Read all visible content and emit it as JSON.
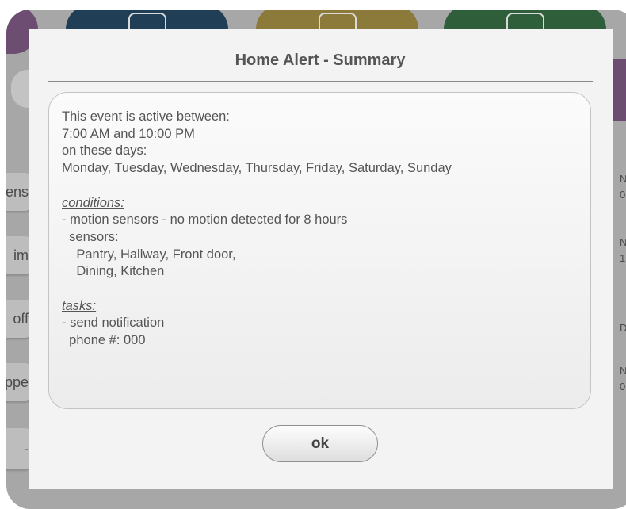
{
  "background": {
    "tiles": [
      "purple",
      "blue",
      "yellow",
      "green"
    ],
    "left_items": [
      "ens",
      "im",
      "off",
      "ppe",
      "-"
    ],
    "right_items": [
      "N\n0",
      "N\n1",
      "D",
      "N\n0"
    ]
  },
  "dialog": {
    "title": "Home Alert - Summary",
    "summary": {
      "active_intro": "This event is active between:",
      "time_range": "7:00 AM and 10:00 PM",
      "days_intro": "on these days:",
      "days": "Monday, Tuesday, Wednesday, Thursday, Friday, Saturday, Sunday",
      "conditions_heading": "conditions:",
      "condition_line": "- motion sensors - no motion detected for 8 hours",
      "sensors_label": "  sensors:",
      "sensors_line1": "    Pantry, Hallway, Front door,",
      "sensors_line2": "    Dining, Kitchen",
      "tasks_heading": "tasks:",
      "task_line": "- send notification",
      "phone_line": "  phone #: 000"
    },
    "ok_label": "ok"
  }
}
